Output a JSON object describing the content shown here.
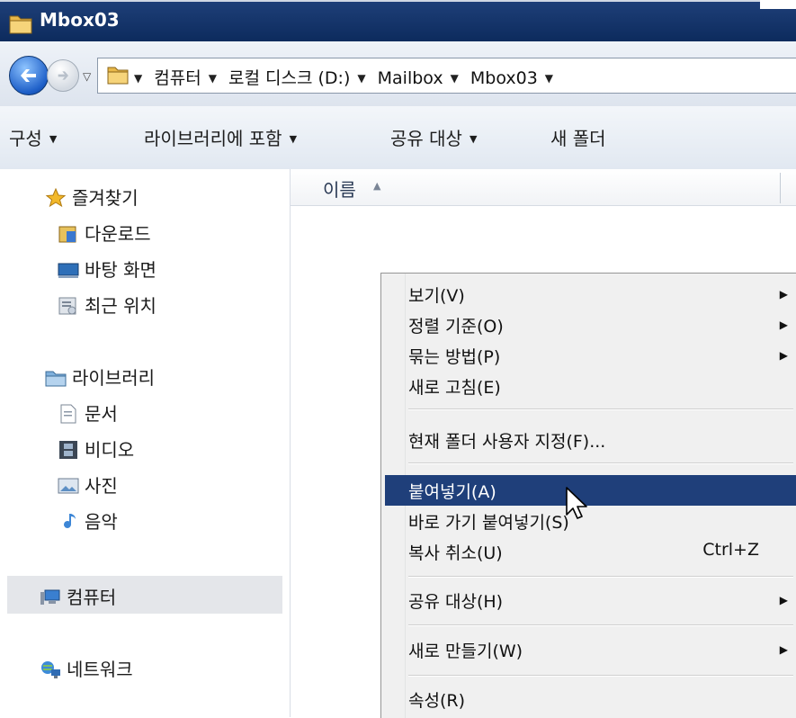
{
  "window": {
    "title": "Mbox03"
  },
  "address": {
    "history_dropdown": "▽",
    "breadcrumbs": [
      "컴퓨터",
      "로컬 디스크 (D:)",
      "Mailbox",
      "Mbox03"
    ]
  },
  "toolbar": {
    "organize": "구성",
    "include_in_library": "라이브러리에 포함",
    "share_with": "공유 대상",
    "new_folder": "새 폴더"
  },
  "nav": {
    "favorites": "즐겨찾기",
    "downloads": "다운로드",
    "desktop": "바탕 화면",
    "recent": "최근 위치",
    "libraries": "라이브러리",
    "documents": "문서",
    "videos": "비디오",
    "pictures": "사진",
    "music": "음악",
    "computer": "컴퓨터",
    "network": "네트워크"
  },
  "content": {
    "column_name": "이름",
    "sort_indicator": "▲"
  },
  "context_menu": {
    "view": "보기(V)",
    "sort_by": "정렬 기준(O)",
    "group_by": "묶는 방법(P)",
    "refresh": "새로 고침(E)",
    "customize_folder": "현재 폴더 사용자 지정(F)...",
    "paste": "붙여넣기(A)",
    "paste_shortcut": "바로 가기 붙여넣기(S)",
    "undo_copy": "복사 취소(U)",
    "undo_shortcut": "Ctrl+Z",
    "share_with": "공유 대상(H)",
    "new": "새로 만들기(W)",
    "properties": "속성(R)",
    "submenu_arrow": "▶"
  },
  "colors": {
    "titlebar": "#0c2a5c",
    "highlight": "#1f3f7a",
    "menu_bg": "#f0f0f0"
  }
}
